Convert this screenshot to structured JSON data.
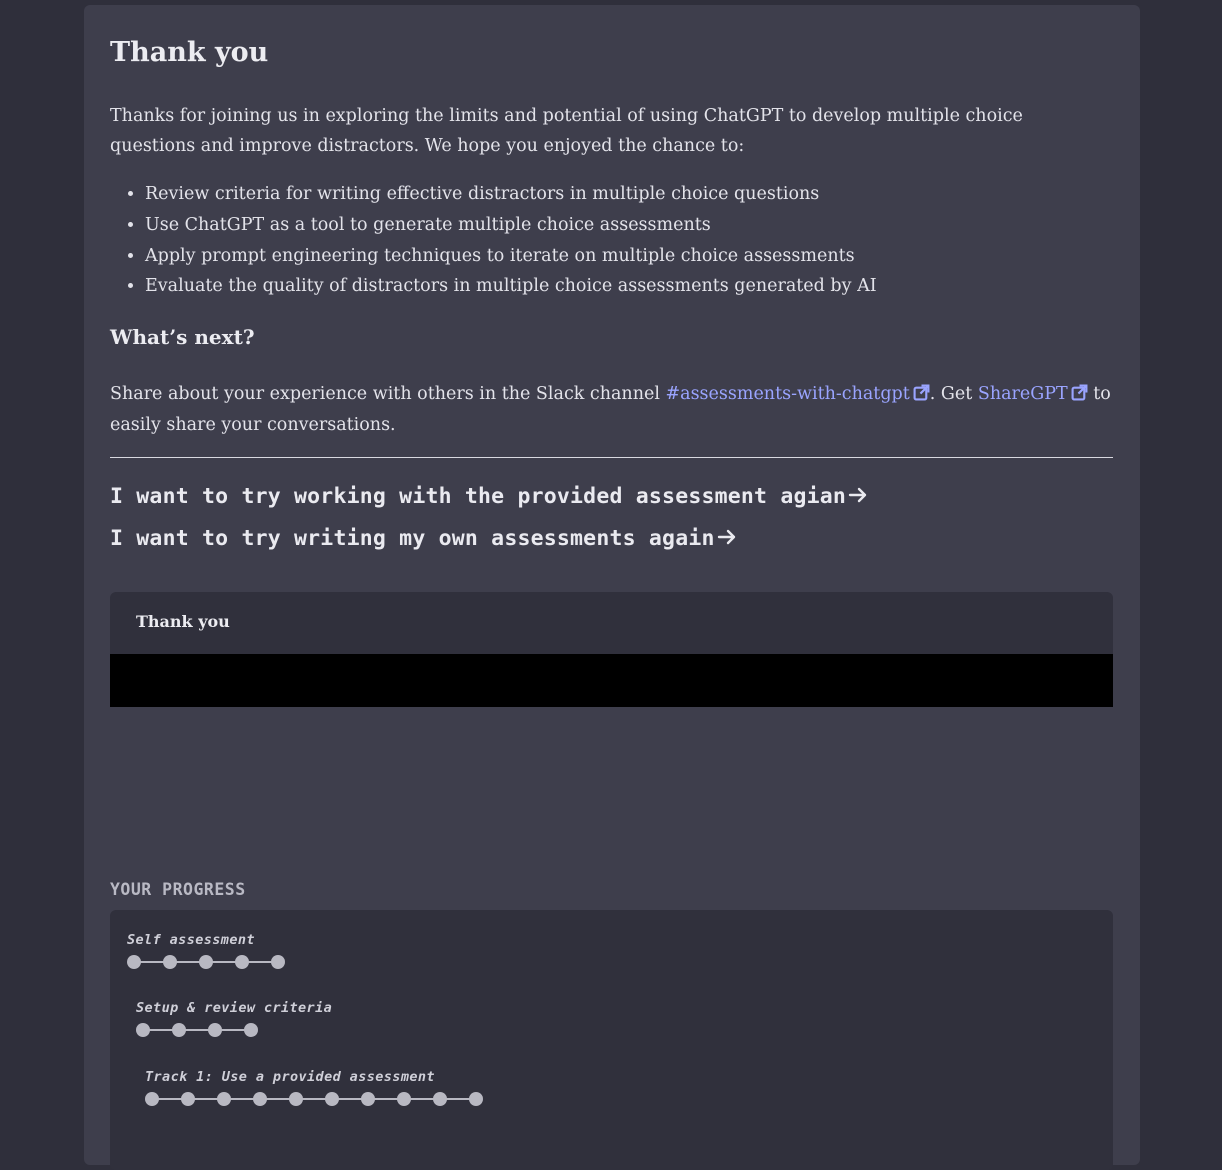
{
  "article": {
    "title": "Thank you",
    "intro": "Thanks for joining us in exploring the limits and potential of using ChatGPT to develop multiple choice questions and improve distractors. We hope you enjoyed the chance to:",
    "goals": [
      "Review criteria for writing effective distractors in multiple choice questions",
      "Use ChatGPT as a tool to generate multiple choice assessments",
      "Apply prompt engineering techniques to iterate on multiple choice assessments",
      "Evaluate the quality of distractors in multiple choice assessments generated by AI"
    ],
    "next_heading": "What’s next?",
    "share": {
      "before": "Share about your experience with others in the Slack channel ",
      "slack_link": "#assessments-with-chatgpt",
      "middle": ". Get ",
      "sharegpt_link": "ShareGPT",
      "after": " to easily share your conversations."
    },
    "actions": [
      "I want to try working with the provided assessment agian",
      "I want to try writing my own assessments again"
    ]
  },
  "video": {
    "title": "Thank you"
  },
  "progress": {
    "label": "YOUR PROGRESS",
    "tracks": [
      {
        "name": "Self assessment",
        "steps": 5
      },
      {
        "name": "Setup & review criteria",
        "steps": 4
      },
      {
        "name": "Track 1: Use a provided assessment",
        "steps": 10
      }
    ]
  },
  "colors": {
    "background": "#2f2f3b",
    "panel": "#3e3e4c",
    "link": "#9aa4ff",
    "dot": "#b8b8c2"
  }
}
